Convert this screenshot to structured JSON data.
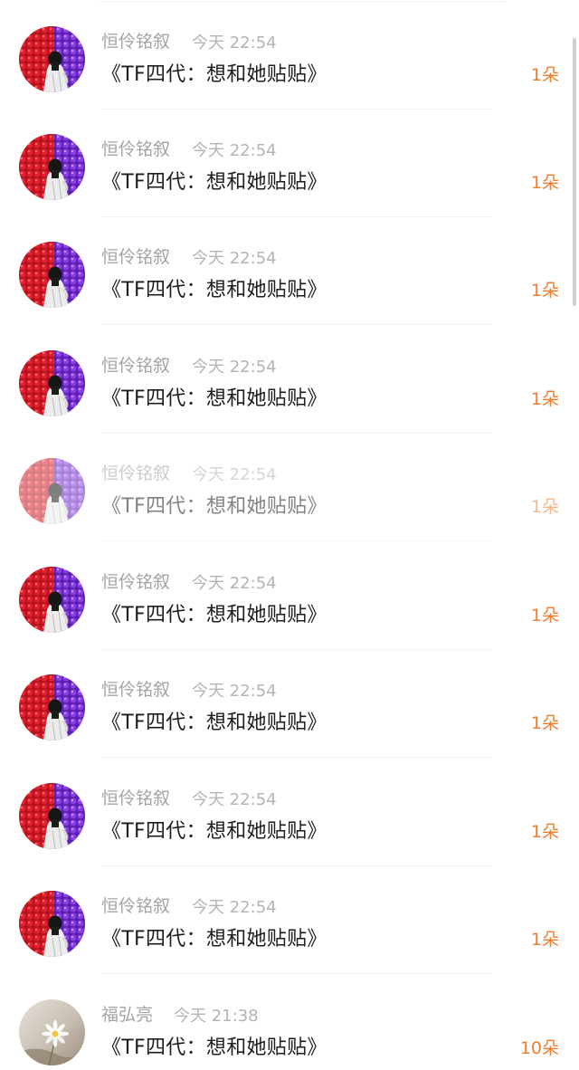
{
  "rows": [
    {
      "name": "恒伶铭叙",
      "time": "今天 22:54",
      "title": "《TF四代：想和她贴贴》",
      "gift": "1朵",
      "avatar": "red-purple-balloons-avatar"
    },
    {
      "name": "恒伶铭叙",
      "time": "今天 22:54",
      "title": "《TF四代：想和她贴贴》",
      "gift": "1朵",
      "avatar": "red-purple-balloons-avatar"
    },
    {
      "name": "恒伶铭叙",
      "time": "今天 22:54",
      "title": "《TF四代：想和她贴贴》",
      "gift": "1朵",
      "avatar": "red-purple-balloons-avatar"
    },
    {
      "name": "恒伶铭叙",
      "time": "今天 22:54",
      "title": "《TF四代：想和她贴贴》",
      "gift": "1朵",
      "avatar": "red-purple-balloons-avatar"
    },
    {
      "name": "恒伶铭叙",
      "time": "今天 22:54",
      "title": "《TF四代：想和她贴贴》",
      "gift": "1朵",
      "avatar": "red-purple-balloons-avatar"
    },
    {
      "name": "恒伶铭叙",
      "time": "今天 22:54",
      "title": "《TF四代：想和她贴贴》",
      "gift": "1朵",
      "avatar": "red-purple-balloons-avatar"
    },
    {
      "name": "恒伶铭叙",
      "time": "今天 22:54",
      "title": "《TF四代：想和她贴贴》",
      "gift": "1朵",
      "avatar": "red-purple-balloons-avatar"
    },
    {
      "name": "恒伶铭叙",
      "time": "今天 22:54",
      "title": "《TF四代：想和她贴贴》",
      "gift": "1朵",
      "avatar": "red-purple-balloons-avatar"
    },
    {
      "name": "恒伶铭叙",
      "time": "今天 22:54",
      "title": "《TF四代：想和她贴贴》",
      "gift": "1朵",
      "avatar": "red-purple-balloons-avatar"
    },
    {
      "name": "福弘亮",
      "time": "今天 21:38",
      "title": "《TF四代：想和她贴贴》",
      "gift": "10朵",
      "avatar": "daisy-flower-avatar"
    }
  ],
  "colors": {
    "gift_accent": "#ef7d2e",
    "name_gray": "#a4a4a4",
    "title_dark": "#1d1d1d"
  }
}
